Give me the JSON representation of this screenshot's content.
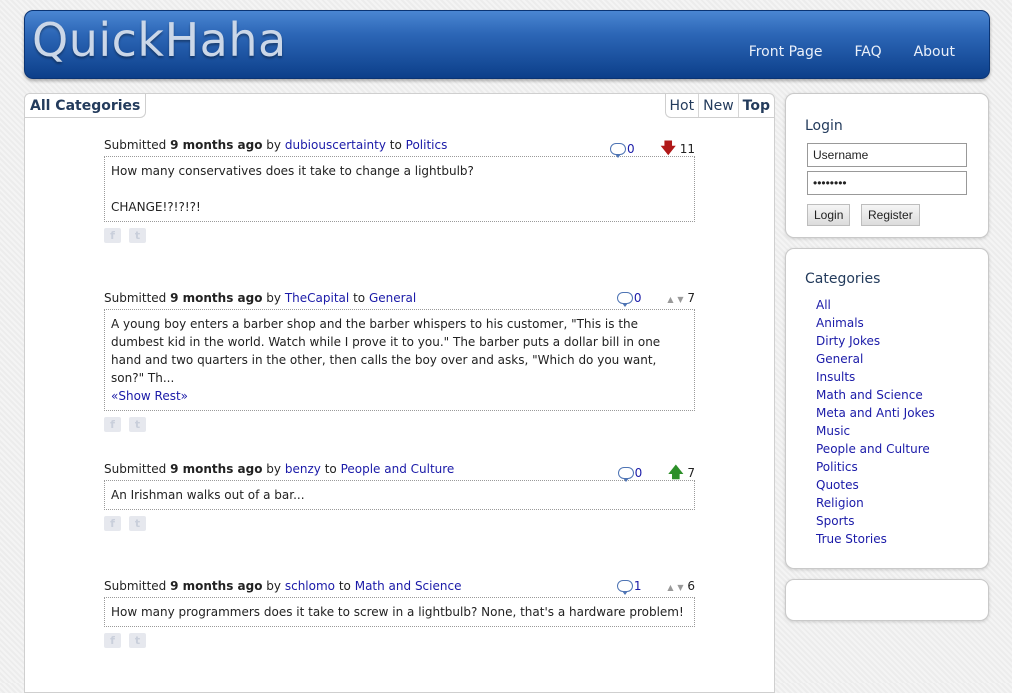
{
  "header": {
    "logo": "QuickHaha",
    "nav": [
      "Front Page",
      "FAQ",
      "About"
    ]
  },
  "main": {
    "category_tab": "All Categories",
    "sort_tabs": [
      {
        "label": "Hot",
        "active": false
      },
      {
        "label": "New",
        "active": false
      },
      {
        "label": "Top",
        "active": true
      }
    ],
    "submitted_prefix": "Submitted",
    "by_word": "by",
    "to_word": "to",
    "posts": [
      {
        "age": "9 months ago",
        "user": "dubiouscertainty",
        "category": "Politics",
        "comments": "0",
        "vote_icon": "red-down-arrow",
        "score": "11",
        "text_line1": "How many conservatives does it take to change a lightbulb?",
        "text_line2": "CHANGE!?!?!?!"
      },
      {
        "age": "9 months ago",
        "user": "TheCapital",
        "category": "General",
        "comments": "0",
        "vote_icon": "gray-up-down",
        "score": "7",
        "text": "A young boy enters a barber shop and the barber whispers to his customer, \"This is the dumbest kid in the world. Watch while I prove it to you.\" The barber puts a dollar bill in one hand and two quarters in the other, then calls the boy over and asks, \"Which do you want, son?\" Th...",
        "show_rest": "«Show Rest»"
      },
      {
        "age": "9 months ago",
        "user": "benzy",
        "category": "People and Culture",
        "comments": "0",
        "vote_icon": "green-up-arrow",
        "score": "7",
        "text": "An Irishman walks out of a bar..."
      },
      {
        "age": "9 months ago",
        "user": "schlomo",
        "category": "Math and Science",
        "comments": "1",
        "vote_icon": "gray-up-down",
        "score": "6",
        "text": "How many programmers does it take to screw in a lightbulb? None, that's a hardware problem!"
      }
    ]
  },
  "login": {
    "title": "Login",
    "username_value": "Username",
    "password_value": "••••••••",
    "login_button": "Login",
    "register_button": "Register"
  },
  "categories": {
    "title": "Categories",
    "items": [
      "All",
      "Animals",
      "Dirty Jokes",
      "General",
      "Insults",
      "Math and Science",
      "Meta and Anti Jokes",
      "Music",
      "People and Culture",
      "Politics",
      "Quotes",
      "Religion",
      "Sports",
      "True Stories"
    ]
  }
}
